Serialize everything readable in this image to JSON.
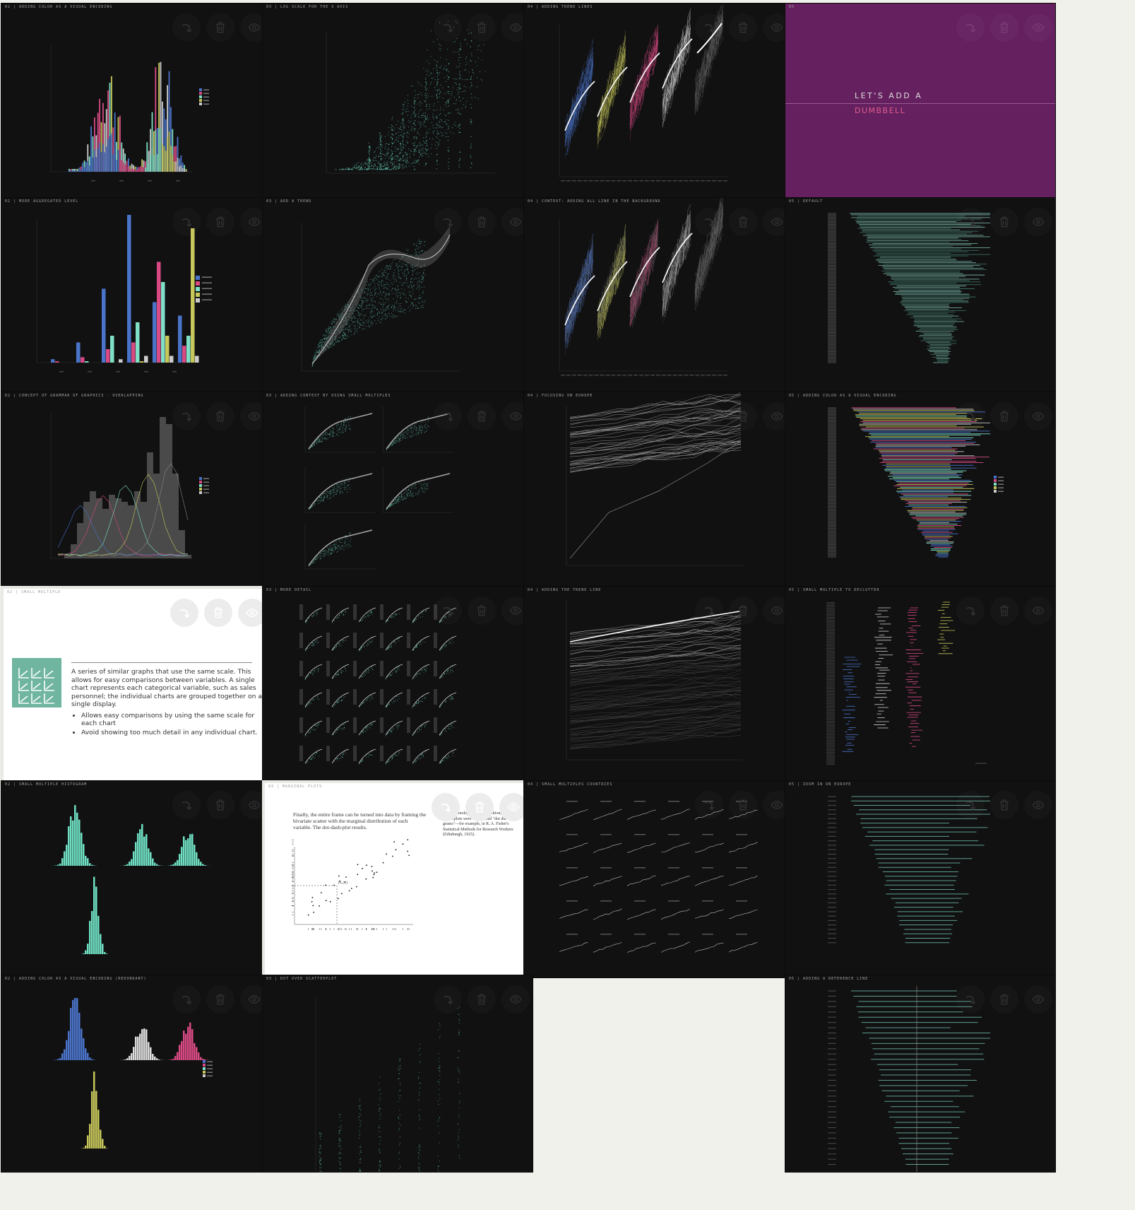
{
  "board": {
    "cards": [
      {
        "title": "02 | Adding color as a visual encoding"
      },
      {
        "title": "03 | Log scale for the X axis"
      },
      {
        "title": "04 | Adding trend lines"
      },
      {
        "title": "05"
      },
      {
        "title": "02 | More aggregated level"
      },
      {
        "title": "03 | Add a trend"
      },
      {
        "title": "04 | Context: adding all line in the background"
      },
      {
        "title": "05 | Default"
      },
      {
        "title": "02 | Concept of grammar of graphics - overlapping"
      },
      {
        "title": "03 | Adding context by using small multiples"
      },
      {
        "title": "04 | Focusing on Europe"
      },
      {
        "title": "05 | Adding color as a visual encoding"
      },
      {
        "title": "02 | Small multiple"
      },
      {
        "title": "03 | More detail"
      },
      {
        "title": "04 | Adding the trend line"
      },
      {
        "title": "05 | Small multiple to declutter"
      },
      {
        "title": "02 | Small multiple histogram"
      },
      {
        "title": "03 | Marginal plots"
      },
      {
        "title": "04 | Small multiples countries"
      },
      {
        "title": "05 | Zoom in on Europe"
      },
      {
        "title": "02 | Adding color as a visual encoding (redundant)"
      },
      {
        "title": "03 | Dot over scatterplot"
      },
      {
        "title": "05 | Adding a reference line"
      }
    ]
  },
  "actions": {
    "rotate": "rotate-icon",
    "delete": "trash-icon",
    "view": "eye-icon"
  },
  "promo": {
    "line1": "LET'S ADD A",
    "line2": "DUMBBELL"
  },
  "slide": {
    "body": "A series of similar graphs that use the same scale. This allows for easy comparisons between variables. A single chart represents each categorical variable, such as sales personnel; the individual charts are grouped together on a single display.",
    "bullets": [
      "Allows easy comparisons by using the same scale for each chart",
      "Avoid showing too much detail in any individual chart."
    ]
  },
  "paper": {
    "text": "Finally, the entire frame can be turned into data by framing the bivariate scatter with the marginal distribution of each variable. The dot-dash-plot results.",
    "note": "The terminology follows tradition, for scatterplots were once called \"dot dia-grams\"—for example, in R. A. Fisher's Statistical Methods for Research Workers (Edinburgh, 1925).",
    "annotation": "(x₁,y₁)"
  },
  "legend": {
    "continents": [
      "Africa",
      "Americas",
      "Asia",
      "Europe",
      "Oceania"
    ]
  },
  "colors": {
    "africa": "#4a74c9",
    "americas": "#d94a84",
    "asia": "#7fe0c8",
    "europe": "#c6c65a",
    "oceania": "#cccccc",
    "mint": "#6fe0c3",
    "purple": "#64205f"
  }
}
